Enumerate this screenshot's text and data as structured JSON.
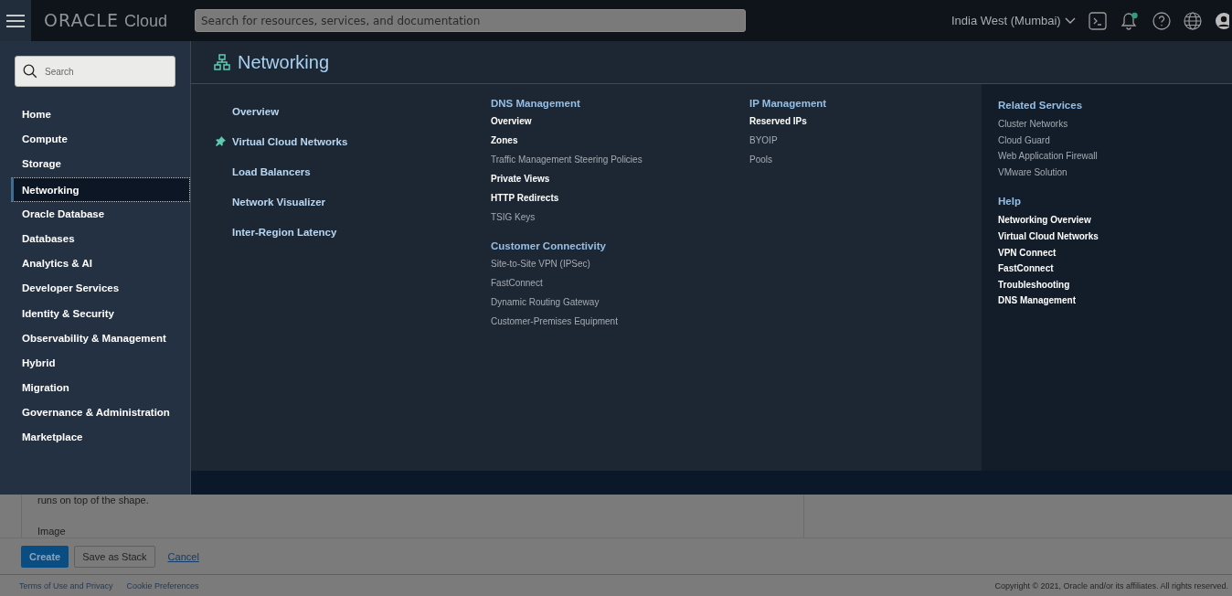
{
  "brand": {
    "logo": "ORACLE",
    "product": "Cloud"
  },
  "search": {
    "placeholder": "Search for resources, services, and documentation"
  },
  "region": "India West (Mumbai)",
  "notifications": {
    "unread": true
  },
  "sidebar": {
    "search_placeholder": "Search",
    "items": [
      {
        "label": "Home",
        "selected": false
      },
      {
        "label": "Compute",
        "selected": false
      },
      {
        "label": "Storage",
        "selected": false
      },
      {
        "label": "Networking",
        "selected": true
      },
      {
        "label": "Oracle Database",
        "selected": false
      },
      {
        "label": "Databases",
        "selected": false
      },
      {
        "label": "Analytics & AI",
        "selected": false
      },
      {
        "label": "Developer Services",
        "selected": false
      },
      {
        "label": "Identity & Security",
        "selected": false
      },
      {
        "label": "Observability & Management",
        "selected": false
      },
      {
        "label": "Hybrid",
        "selected": false
      },
      {
        "label": "Migration",
        "selected": false
      },
      {
        "label": "Governance & Administration",
        "selected": false
      },
      {
        "label": "Marketplace",
        "selected": false
      }
    ]
  },
  "panel": {
    "title": "Networking",
    "main_links": [
      {
        "label": "Overview",
        "pinned": false
      },
      {
        "label": "Virtual Cloud Networks",
        "pinned": true
      },
      {
        "label": "Load Balancers",
        "pinned": false
      },
      {
        "label": "Network Visualizer",
        "pinned": false
      },
      {
        "label": "Inter-Region Latency",
        "pinned": false
      }
    ],
    "columns": [
      [
        {
          "heading": "DNS Management",
          "links": [
            {
              "label": "Overview",
              "kind": "primary"
            },
            {
              "label": "Zones",
              "kind": "primary"
            },
            {
              "label": "Traffic Management Steering Policies",
              "kind": "secondary"
            },
            {
              "label": "Private Views",
              "kind": "primary"
            },
            {
              "label": "HTTP Redirects",
              "kind": "primary"
            },
            {
              "label": "TSIG Keys",
              "kind": "secondary"
            }
          ]
        },
        {
          "heading": "Customer Connectivity",
          "links": [
            {
              "label": "Site-to-Site VPN (IPSec)",
              "kind": "secondary"
            },
            {
              "label": "FastConnect",
              "kind": "secondary"
            },
            {
              "label": "Dynamic Routing Gateway",
              "kind": "secondary"
            },
            {
              "label": "Customer-Premises Equipment",
              "kind": "secondary"
            }
          ]
        }
      ],
      [
        {
          "heading": "IP Management",
          "links": [
            {
              "label": "Reserved IPs",
              "kind": "primary"
            },
            {
              "label": "BYOIP",
              "kind": "secondary"
            },
            {
              "label": "Pools",
              "kind": "secondary"
            }
          ]
        }
      ]
    ],
    "side": [
      {
        "heading": "Related Services",
        "links": [
          {
            "label": "Cluster Networks",
            "kind": "secondary"
          },
          {
            "label": "Cloud Guard",
            "kind": "secondary"
          },
          {
            "label": "Web Application Firewall",
            "kind": "secondary"
          },
          {
            "label": "VMware Solution",
            "kind": "secondary"
          }
        ]
      },
      {
        "heading": "Help",
        "links": [
          {
            "label": "Networking Overview",
            "kind": "primary"
          },
          {
            "label": "Virtual Cloud Networks",
            "kind": "primary"
          },
          {
            "label": "VPN Connect",
            "kind": "primary"
          },
          {
            "label": "FastConnect",
            "kind": "primary"
          },
          {
            "label": "Troubleshooting",
            "kind": "primary"
          },
          {
            "label": "DNS Management",
            "kind": "primary"
          }
        ]
      }
    ]
  },
  "page": {
    "text_lines": [
      "runs on top of the shape.",
      "Image"
    ],
    "buttons": [
      {
        "label": "Create",
        "kind": "primary"
      },
      {
        "label": "Save as Stack",
        "kind": "secondary"
      },
      {
        "label": "Cancel",
        "kind": "link"
      }
    ],
    "footer_links": [
      "Terms of Use and Privacy",
      "Cookie Preferences"
    ],
    "copyright": "Copyright © 2021, Oracle and/or its affiliates. All rights reserved."
  }
}
